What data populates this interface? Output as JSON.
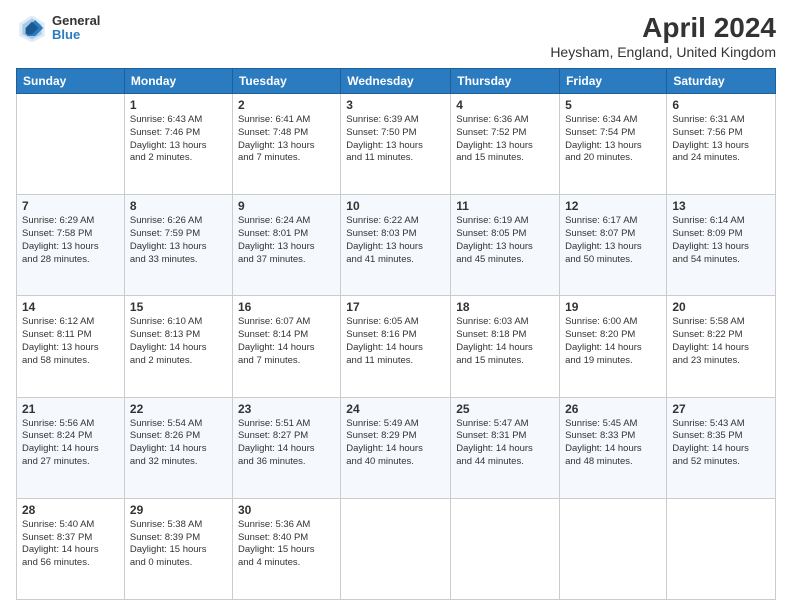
{
  "header": {
    "logo": {
      "line1": "General",
      "line2": "Blue"
    },
    "month": "April 2024",
    "location": "Heysham, England, United Kingdom"
  },
  "columns": [
    "Sunday",
    "Monday",
    "Tuesday",
    "Wednesday",
    "Thursday",
    "Friday",
    "Saturday"
  ],
  "weeks": [
    [
      {
        "day": "",
        "info": ""
      },
      {
        "day": "1",
        "info": "Sunrise: 6:43 AM\nSunset: 7:46 PM\nDaylight: 13 hours\nand 2 minutes."
      },
      {
        "day": "2",
        "info": "Sunrise: 6:41 AM\nSunset: 7:48 PM\nDaylight: 13 hours\nand 7 minutes."
      },
      {
        "day": "3",
        "info": "Sunrise: 6:39 AM\nSunset: 7:50 PM\nDaylight: 13 hours\nand 11 minutes."
      },
      {
        "day": "4",
        "info": "Sunrise: 6:36 AM\nSunset: 7:52 PM\nDaylight: 13 hours\nand 15 minutes."
      },
      {
        "day": "5",
        "info": "Sunrise: 6:34 AM\nSunset: 7:54 PM\nDaylight: 13 hours\nand 20 minutes."
      },
      {
        "day": "6",
        "info": "Sunrise: 6:31 AM\nSunset: 7:56 PM\nDaylight: 13 hours\nand 24 minutes."
      }
    ],
    [
      {
        "day": "7",
        "info": "Sunrise: 6:29 AM\nSunset: 7:58 PM\nDaylight: 13 hours\nand 28 minutes."
      },
      {
        "day": "8",
        "info": "Sunrise: 6:26 AM\nSunset: 7:59 PM\nDaylight: 13 hours\nand 33 minutes."
      },
      {
        "day": "9",
        "info": "Sunrise: 6:24 AM\nSunset: 8:01 PM\nDaylight: 13 hours\nand 37 minutes."
      },
      {
        "day": "10",
        "info": "Sunrise: 6:22 AM\nSunset: 8:03 PM\nDaylight: 13 hours\nand 41 minutes."
      },
      {
        "day": "11",
        "info": "Sunrise: 6:19 AM\nSunset: 8:05 PM\nDaylight: 13 hours\nand 45 minutes."
      },
      {
        "day": "12",
        "info": "Sunrise: 6:17 AM\nSunset: 8:07 PM\nDaylight: 13 hours\nand 50 minutes."
      },
      {
        "day": "13",
        "info": "Sunrise: 6:14 AM\nSunset: 8:09 PM\nDaylight: 13 hours\nand 54 minutes."
      }
    ],
    [
      {
        "day": "14",
        "info": "Sunrise: 6:12 AM\nSunset: 8:11 PM\nDaylight: 13 hours\nand 58 minutes."
      },
      {
        "day": "15",
        "info": "Sunrise: 6:10 AM\nSunset: 8:13 PM\nDaylight: 14 hours\nand 2 minutes."
      },
      {
        "day": "16",
        "info": "Sunrise: 6:07 AM\nSunset: 8:14 PM\nDaylight: 14 hours\nand 7 minutes."
      },
      {
        "day": "17",
        "info": "Sunrise: 6:05 AM\nSunset: 8:16 PM\nDaylight: 14 hours\nand 11 minutes."
      },
      {
        "day": "18",
        "info": "Sunrise: 6:03 AM\nSunset: 8:18 PM\nDaylight: 14 hours\nand 15 minutes."
      },
      {
        "day": "19",
        "info": "Sunrise: 6:00 AM\nSunset: 8:20 PM\nDaylight: 14 hours\nand 19 minutes."
      },
      {
        "day": "20",
        "info": "Sunrise: 5:58 AM\nSunset: 8:22 PM\nDaylight: 14 hours\nand 23 minutes."
      }
    ],
    [
      {
        "day": "21",
        "info": "Sunrise: 5:56 AM\nSunset: 8:24 PM\nDaylight: 14 hours\nand 27 minutes."
      },
      {
        "day": "22",
        "info": "Sunrise: 5:54 AM\nSunset: 8:26 PM\nDaylight: 14 hours\nand 32 minutes."
      },
      {
        "day": "23",
        "info": "Sunrise: 5:51 AM\nSunset: 8:27 PM\nDaylight: 14 hours\nand 36 minutes."
      },
      {
        "day": "24",
        "info": "Sunrise: 5:49 AM\nSunset: 8:29 PM\nDaylight: 14 hours\nand 40 minutes."
      },
      {
        "day": "25",
        "info": "Sunrise: 5:47 AM\nSunset: 8:31 PM\nDaylight: 14 hours\nand 44 minutes."
      },
      {
        "day": "26",
        "info": "Sunrise: 5:45 AM\nSunset: 8:33 PM\nDaylight: 14 hours\nand 48 minutes."
      },
      {
        "day": "27",
        "info": "Sunrise: 5:43 AM\nSunset: 8:35 PM\nDaylight: 14 hours\nand 52 minutes."
      }
    ],
    [
      {
        "day": "28",
        "info": "Sunrise: 5:40 AM\nSunset: 8:37 PM\nDaylight: 14 hours\nand 56 minutes."
      },
      {
        "day": "29",
        "info": "Sunrise: 5:38 AM\nSunset: 8:39 PM\nDaylight: 15 hours\nand 0 minutes."
      },
      {
        "day": "30",
        "info": "Sunrise: 5:36 AM\nSunset: 8:40 PM\nDaylight: 15 hours\nand 4 minutes."
      },
      {
        "day": "",
        "info": ""
      },
      {
        "day": "",
        "info": ""
      },
      {
        "day": "",
        "info": ""
      },
      {
        "day": "",
        "info": ""
      }
    ]
  ]
}
